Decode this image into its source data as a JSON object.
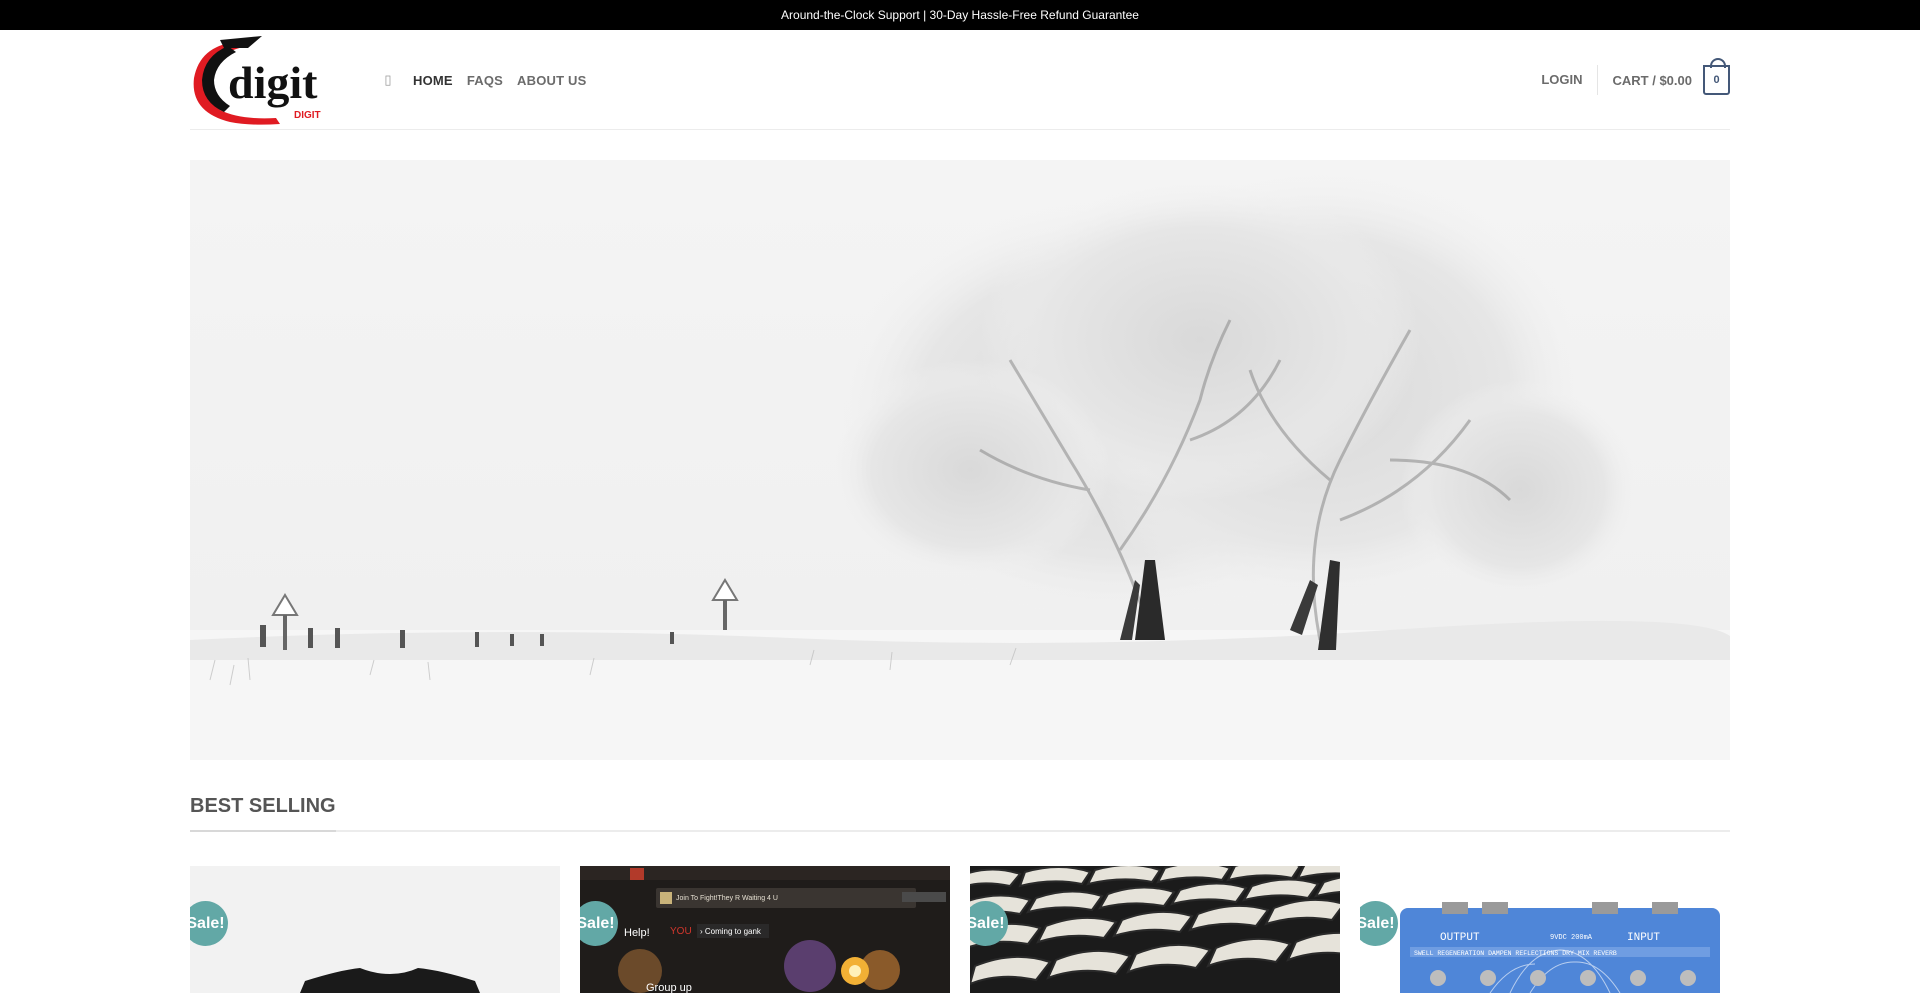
{
  "topbar": {
    "text": "Around-the-Clock Support | 30-Day Hassle-Free Refund Guarantee"
  },
  "brand": {
    "logo_text": "digit",
    "logo_small_text": "DIGIT",
    "accent_color": "#e01b22",
    "dark_color": "#111111"
  },
  "nav": {
    "icon": "search-icon",
    "items": [
      {
        "label": "HOME",
        "active": true
      },
      {
        "label": "FAQS",
        "active": false
      },
      {
        "label": "ABOUT US",
        "active": false
      }
    ]
  },
  "account": {
    "login_label": "LOGIN"
  },
  "cart": {
    "label": "CART / $0.00",
    "count": "0",
    "icon": "shopping-bag-icon",
    "color": "#445878"
  },
  "hero": {
    "alt": "snowy-landscape"
  },
  "best_selling": {
    "title": "BEST SELLING",
    "badge_color": "#62a8a6",
    "products": [
      {
        "badge": "Sale!",
        "thumb": "black-tshirt"
      },
      {
        "badge": "Sale!",
        "thumb": "dota-game-screenshot",
        "game_text": {
          "join": "Join To Fight!They R Waiting 4 U",
          "help": "Help!",
          "you": "YOU",
          "coming": "› Coming to gank",
          "group": "Group up"
        }
      },
      {
        "badge": "Sale!",
        "thumb": "honeycomb-grid"
      },
      {
        "badge": "Sale!",
        "thumb": "guitar-pedal",
        "pedal_text": {
          "output": "OUTPUT",
          "input": "INPUT",
          "power": "9VDC 200mA",
          "knobs": "SWELL   REGENERATION   DAMPEN   REFLECTIONS   DRY MIX   REVERB"
        }
      }
    ]
  }
}
